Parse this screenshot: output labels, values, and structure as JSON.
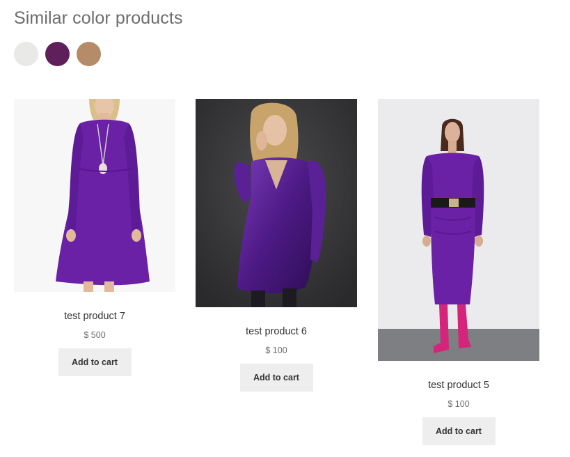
{
  "section": {
    "title": "Similar color products"
  },
  "swatches": [
    {
      "name": "light-gray",
      "color": "#e9e9e8"
    },
    {
      "name": "plum",
      "color": "#5e1f5a"
    },
    {
      "name": "tan",
      "color": "#b48c6a"
    }
  ],
  "products": [
    {
      "title": "test product 7",
      "price": "$ 500",
      "button_label": "Add to cart",
      "image_icon": "purple-midi-dress-photo"
    },
    {
      "title": "test product 6",
      "price": "$ 100",
      "button_label": "Add to cart",
      "image_icon": "purple-velvet-dress-photo"
    },
    {
      "title": "test product 5",
      "price": "$ 100",
      "button_label": "Add to cart",
      "image_icon": "purple-belted-dress-photo"
    }
  ],
  "colors": {
    "dress_purple": "#6a21a6",
    "button_bg": "#eeeeee"
  }
}
